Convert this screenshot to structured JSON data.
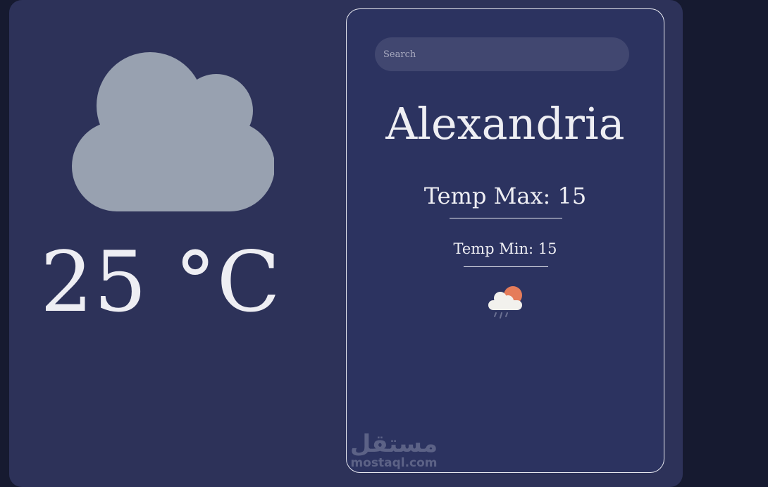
{
  "current": {
    "temperature": "25 °C",
    "icon": "cloud-icon"
  },
  "search": {
    "placeholder": "Search"
  },
  "details": {
    "city": "Alexandria",
    "temp_max": "Temp Max: 15",
    "temp_min": "Temp Min: 15",
    "icon": "cloud-sun-rain-icon"
  },
  "watermark": {
    "arabic": "مستقل",
    "latin": "mostaql.com"
  },
  "colors": {
    "page_bg": "#161a30",
    "card_bg": "#2d3259",
    "panel_bg": "#2c3360",
    "cloud": "#98a1b0",
    "text": "#eeeef3",
    "sun": "#e57c5a"
  }
}
